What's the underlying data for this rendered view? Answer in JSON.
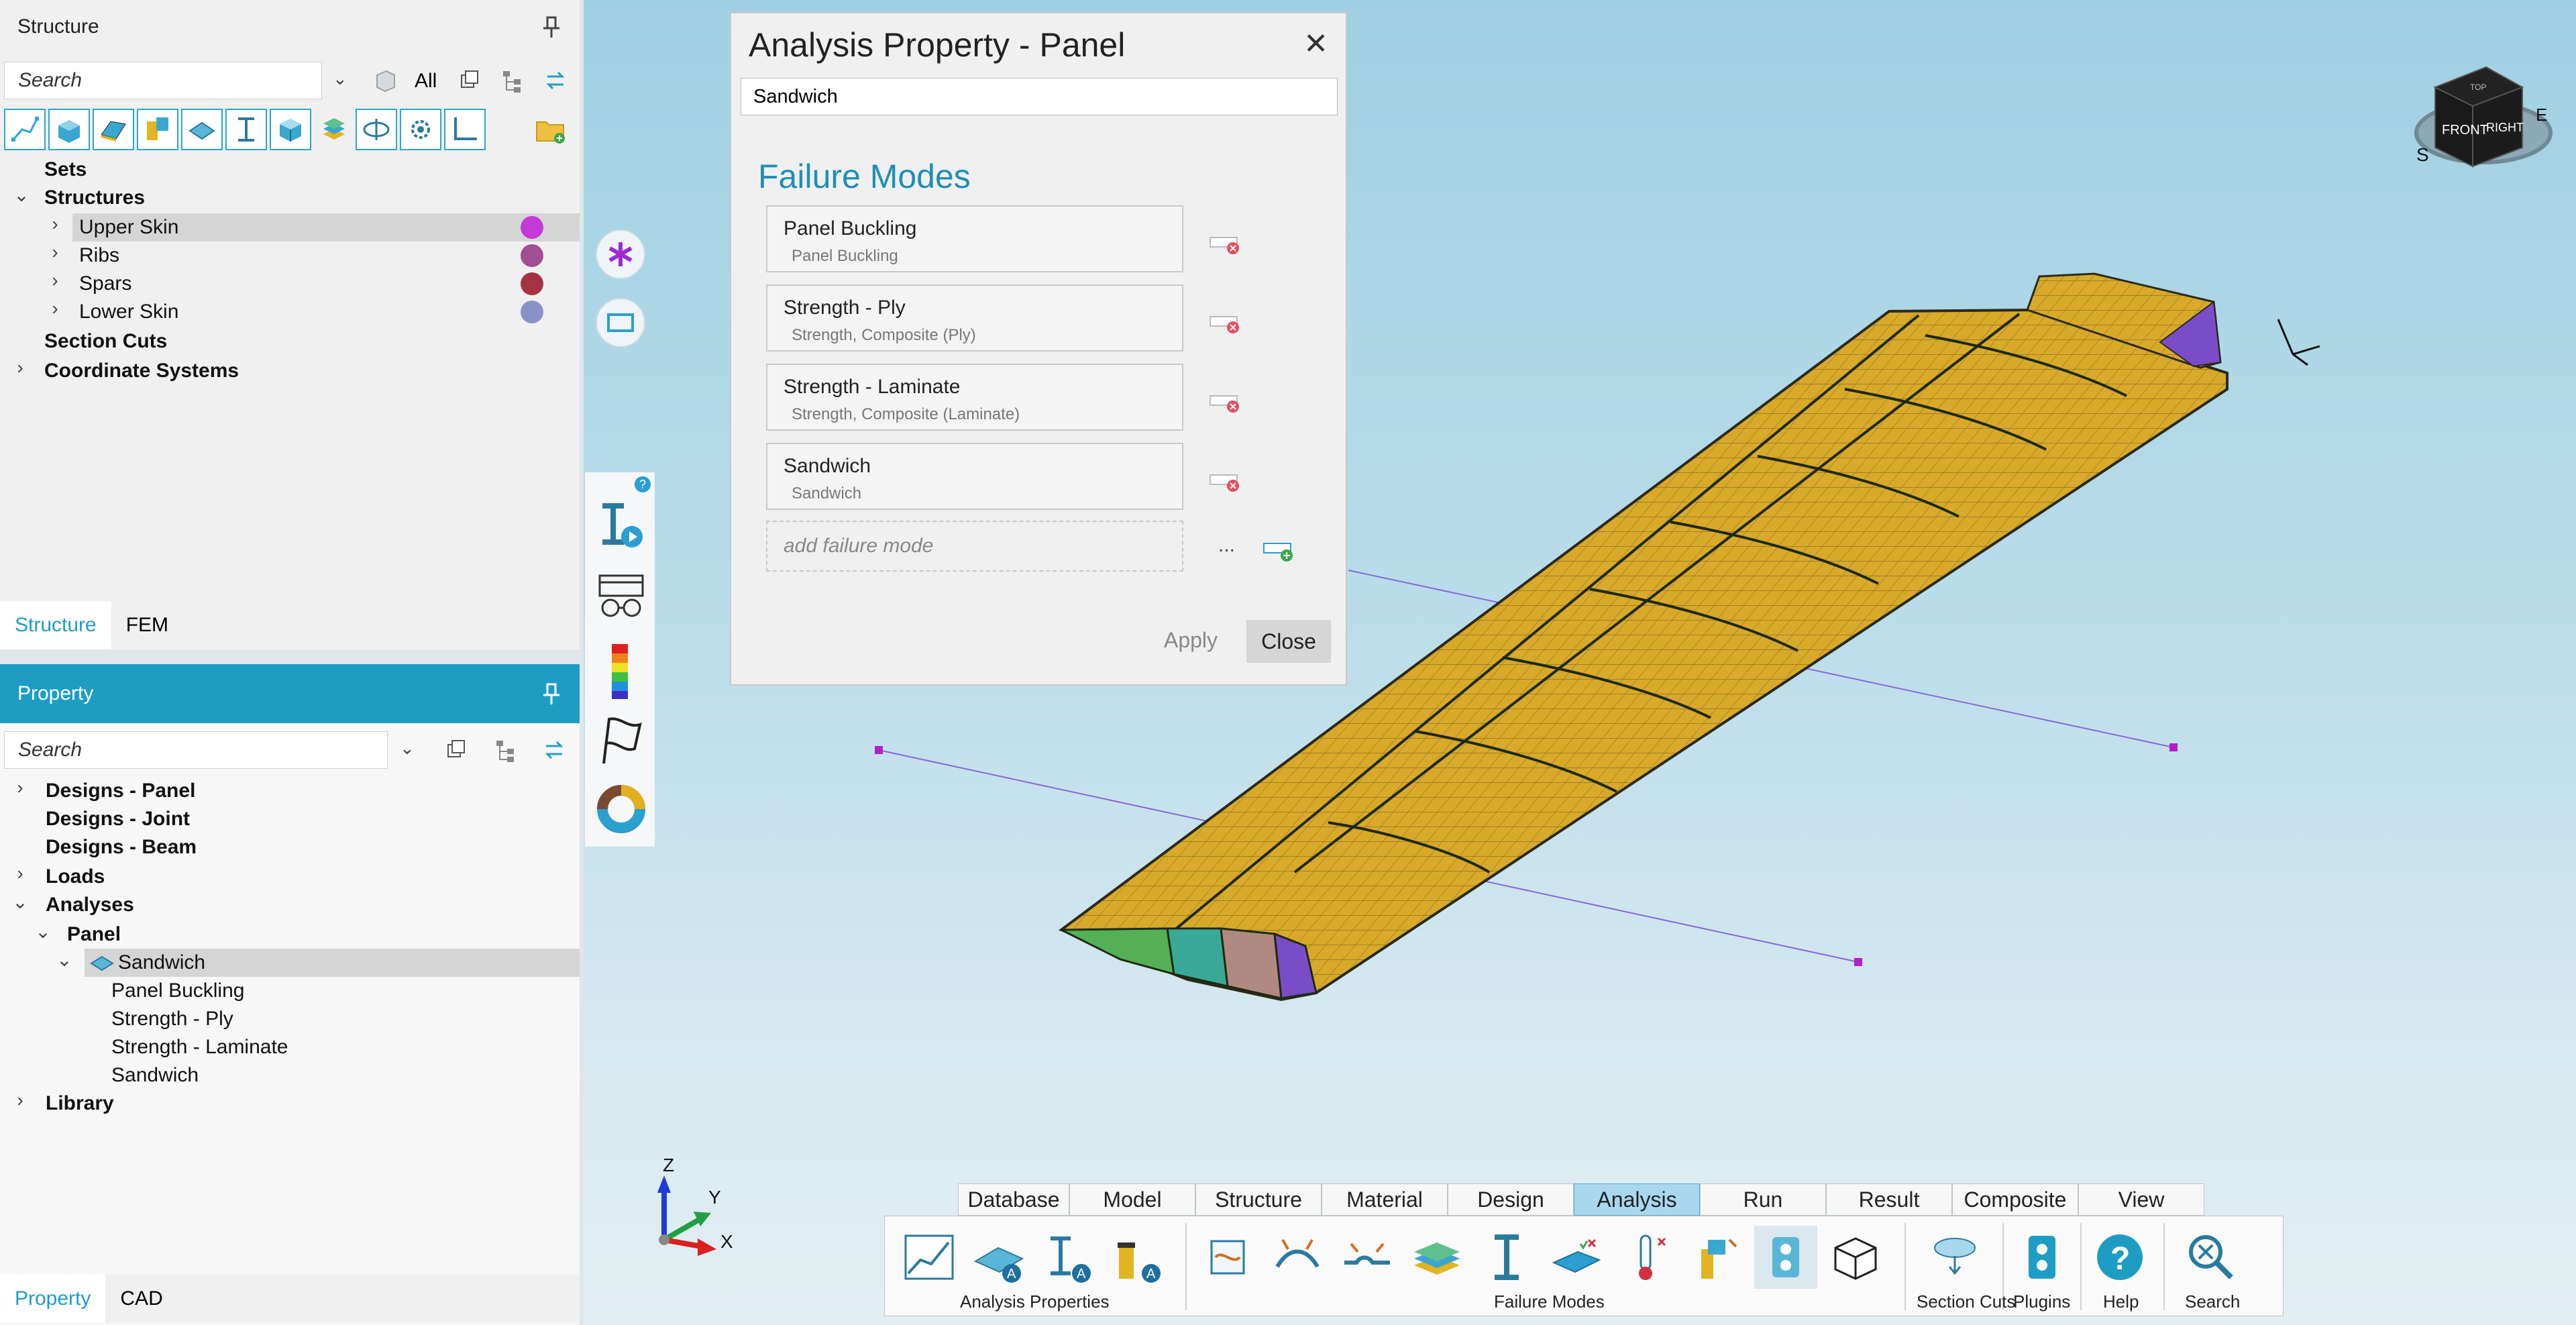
{
  "structure_panel": {
    "title": "Structure",
    "search_placeholder": "Search",
    "filter_label": "All",
    "tree": {
      "sets": "Sets",
      "structures": "Structures",
      "upper_skin": "Upper Skin",
      "ribs": "Ribs",
      "spars": "Spars",
      "lower_skin": "Lower Skin",
      "section_cuts": "Section Cuts",
      "coordinate_systems": "Coordinate Systems"
    },
    "colors": {
      "upper_skin": "#c43ad6",
      "ribs": "#a24e93",
      "spars": "#a63344",
      "lower_skin": "#8891c8"
    },
    "tabs": [
      "Structure",
      "FEM"
    ]
  },
  "property_panel": {
    "title": "Property",
    "search_placeholder": "Search",
    "tree": {
      "designs_panel": "Designs - Panel",
      "designs_joint": "Designs - Joint",
      "designs_beam": "Designs - Beam",
      "loads": "Loads",
      "analyses": "Analyses",
      "panel": "Panel",
      "sandwich": "Sandwich",
      "panel_buckling": "Panel Buckling",
      "strength_ply": "Strength - Ply",
      "strength_laminate": "Strength - Laminate",
      "sandwich_mode": "Sandwich",
      "library": "Library"
    },
    "tabs": [
      "Property",
      "CAD"
    ]
  },
  "dialog": {
    "title": "Analysis Property - Panel",
    "close_glyph": "✕",
    "name_value": "Sandwich",
    "section_heading": "Failure Modes",
    "failure_modes": [
      {
        "name": "Panel Buckling",
        "sub": "Panel Buckling"
      },
      {
        "name": "Strength - Ply",
        "sub": "Strength, Composite (Ply)"
      },
      {
        "name": "Strength - Laminate",
        "sub": "Strength, Composite (Laminate)"
      },
      {
        "name": "Sandwich",
        "sub": "Sandwich"
      }
    ],
    "add_placeholder": "add failure mode",
    "more_glyph": "...",
    "apply_label": "Apply",
    "close_label": "Close"
  },
  "view_cube": {
    "front": "FRONT",
    "right": "RIGHT",
    "top": "TOP",
    "s": "S",
    "e": "E"
  },
  "triad": {
    "x": "X",
    "y": "Y",
    "z": "Z"
  },
  "tool_strip": {
    "help_glyph": "?"
  },
  "ribbon": {
    "tabs": [
      "Database",
      "Model",
      "Structure",
      "Material",
      "Design",
      "Analysis",
      "Run",
      "Result",
      "Composite",
      "View"
    ],
    "active_tab": "Analysis",
    "groups": {
      "analysis_properties": "Analysis Properties",
      "failure_modes": "Failure Modes",
      "section_cuts": "Section Cuts",
      "plugins": "Plugins",
      "help": "Help",
      "search": "Search"
    }
  }
}
